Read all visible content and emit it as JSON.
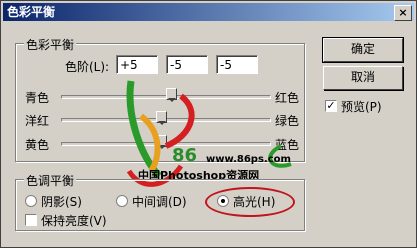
{
  "window": {
    "title": "色彩平衡",
    "close_glyph": "×"
  },
  "color_balance": {
    "legend": "色彩平衡",
    "levels_label": "色阶(L):",
    "levels": [
      "+5",
      "-5",
      "-5"
    ],
    "sliders": [
      {
        "left": "青色",
        "right": "红色",
        "value": 5
      },
      {
        "left": "洋红",
        "right": "绿色",
        "value": -5
      },
      {
        "left": "黄色",
        "right": "蓝色",
        "value": -5
      }
    ]
  },
  "tone_balance": {
    "legend": "色调平衡",
    "shadows": "阴影(S)",
    "midtones": "中间调(D)",
    "highlights": "高光(H)",
    "selected": "highlights",
    "preserve_luminosity": "保持亮度(V)",
    "preserve_checked": false
  },
  "buttons": {
    "ok": "确定",
    "cancel": "取消"
  },
  "preview": {
    "label": "预览(P)",
    "checked": true
  },
  "watermark": {
    "logo_number": "86",
    "site": "www.86ps.com",
    "name": "中国Photoshop资源网"
  },
  "colors": {
    "annotation_ring": "#c0141c"
  }
}
